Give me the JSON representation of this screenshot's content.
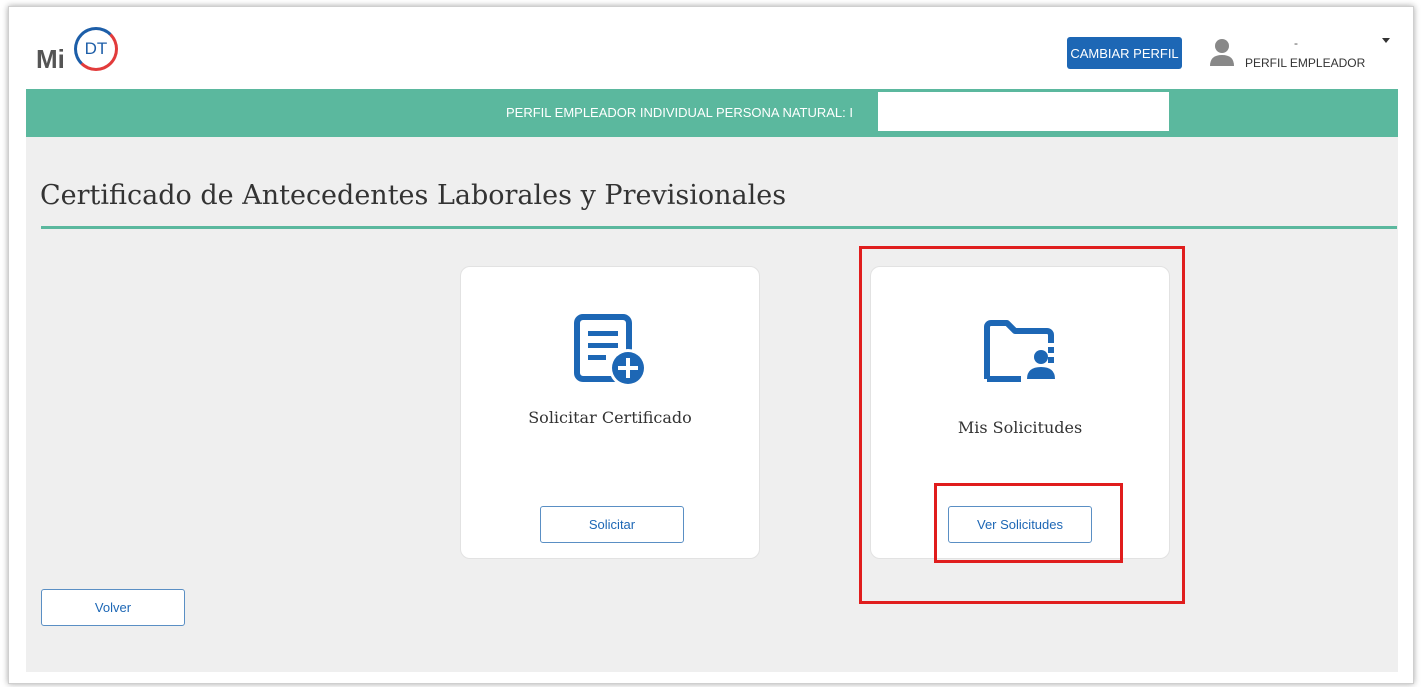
{
  "header": {
    "logo_mi": "Mi",
    "logo_dt": "DT",
    "change_profile_label": "CAMBIAR PERFIL",
    "user_name": "-",
    "user_role": "PERFIL EMPLEADOR"
  },
  "banner": {
    "text": "PERFIL EMPLEADOR INDIVIDUAL PERSONA NATURAL: I"
  },
  "page": {
    "title": "Certificado de Antecedentes Laborales y Previsionales"
  },
  "cards": [
    {
      "title": "Solicitar Certificado",
      "button_label": "Solicitar",
      "icon": "document-plus-icon"
    },
    {
      "title": "Mis Solicitudes",
      "button_label": "Ver Solicitudes",
      "icon": "folder-user-icon"
    }
  ],
  "back_button_label": "Volver",
  "colors": {
    "accent_green": "#5bb89e",
    "primary_blue": "#1d67b5",
    "highlight_red": "#e01d1d"
  }
}
